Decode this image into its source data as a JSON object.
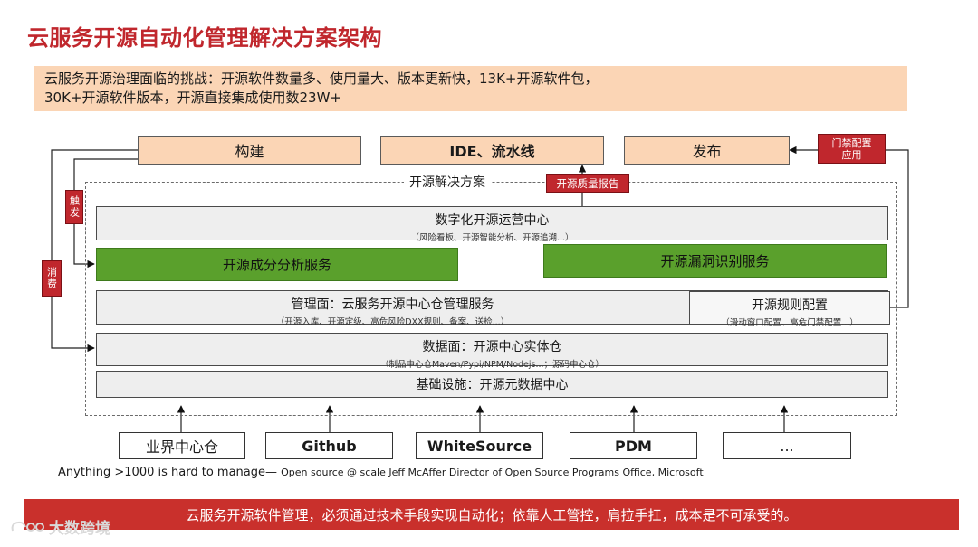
{
  "title": "云服务开源自动化管理解决方案架构",
  "challenge": {
    "line1": "云服务开源治理面临的挑战：开源软件数量多、使用量大、版本更新快，13K+开源软件包，",
    "line2": "30K+开源软件版本，开源直接集成使用数23W+"
  },
  "top_boxes": {
    "build": "构建",
    "ide": "IDE、流水线",
    "release": "发布"
  },
  "gate_config": "门禁配置应用",
  "trigger": "触发",
  "consume": "消费",
  "solution_label": "开源解决方案",
  "quality_report": "开源质量报告",
  "ops_center": {
    "title": "数字化开源运营中心",
    "sub": "（风险看板、开源智能分析、开源追溯...）"
  },
  "composition": "开源成分分析服务",
  "vuln": "开源漏洞识别服务",
  "mgmt": {
    "title": "管理面：云服务开源中心仓管理服务",
    "sub": "（开源入库、开源定级、高危风险DXX规则、备案、送检...）"
  },
  "rules": {
    "title": "开源规则配置",
    "sub": "（滑动窗口配置、高危门禁配置...）"
  },
  "data_plane": {
    "title": "数据面：开源中心实体仓",
    "sub": "（制品中心仓Maven/Pypi/NPM/Nodejs...；源码中心仓）"
  },
  "infra": "基础设施：开源元数据中心",
  "sources": [
    "业界中心仓",
    "Github",
    "WhiteSource",
    "PDM",
    "..."
  ],
  "quote": {
    "main": "Anything >1000 is hard to manage— ",
    "small": "Open source @ scale  Jeff McAffer Director of Open Source Programs Office, Microsoft"
  },
  "footer": "云服务开源软件管理，必须通过技术手段实现自动化；依靠人工管控，肩拉手扛，成本是不可承受的。",
  "watermark": "大数跨境"
}
